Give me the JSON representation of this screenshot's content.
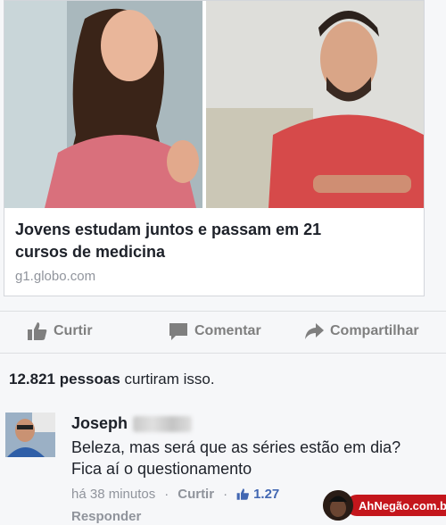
{
  "post": {
    "link_preview": {
      "headline": "Jovens estudam juntos e passam em 21 cursos de medicina",
      "domain": "g1.globo.com"
    },
    "actions": {
      "like_label": "Curtir",
      "comment_label": "Comentar",
      "share_label": "Compartilhar"
    },
    "likes_summary": {
      "count": "12.821",
      "people": "pessoas",
      "rest": " curtiram isso."
    },
    "comment": {
      "author": "Joseph",
      "text": "Beleza, mas será que as séries estão em dia? Fica aí o questionamento",
      "time": "há 38 minutos",
      "like_label": "Curtir",
      "like_count": "1.27",
      "reply_label": "Responder"
    }
  },
  "watermark": {
    "text": "AhNegão.com.br"
  },
  "colors": {
    "facebook_blue": "#4267b2",
    "muted_text": "#90949c",
    "watermark_red": "#c4161c"
  }
}
